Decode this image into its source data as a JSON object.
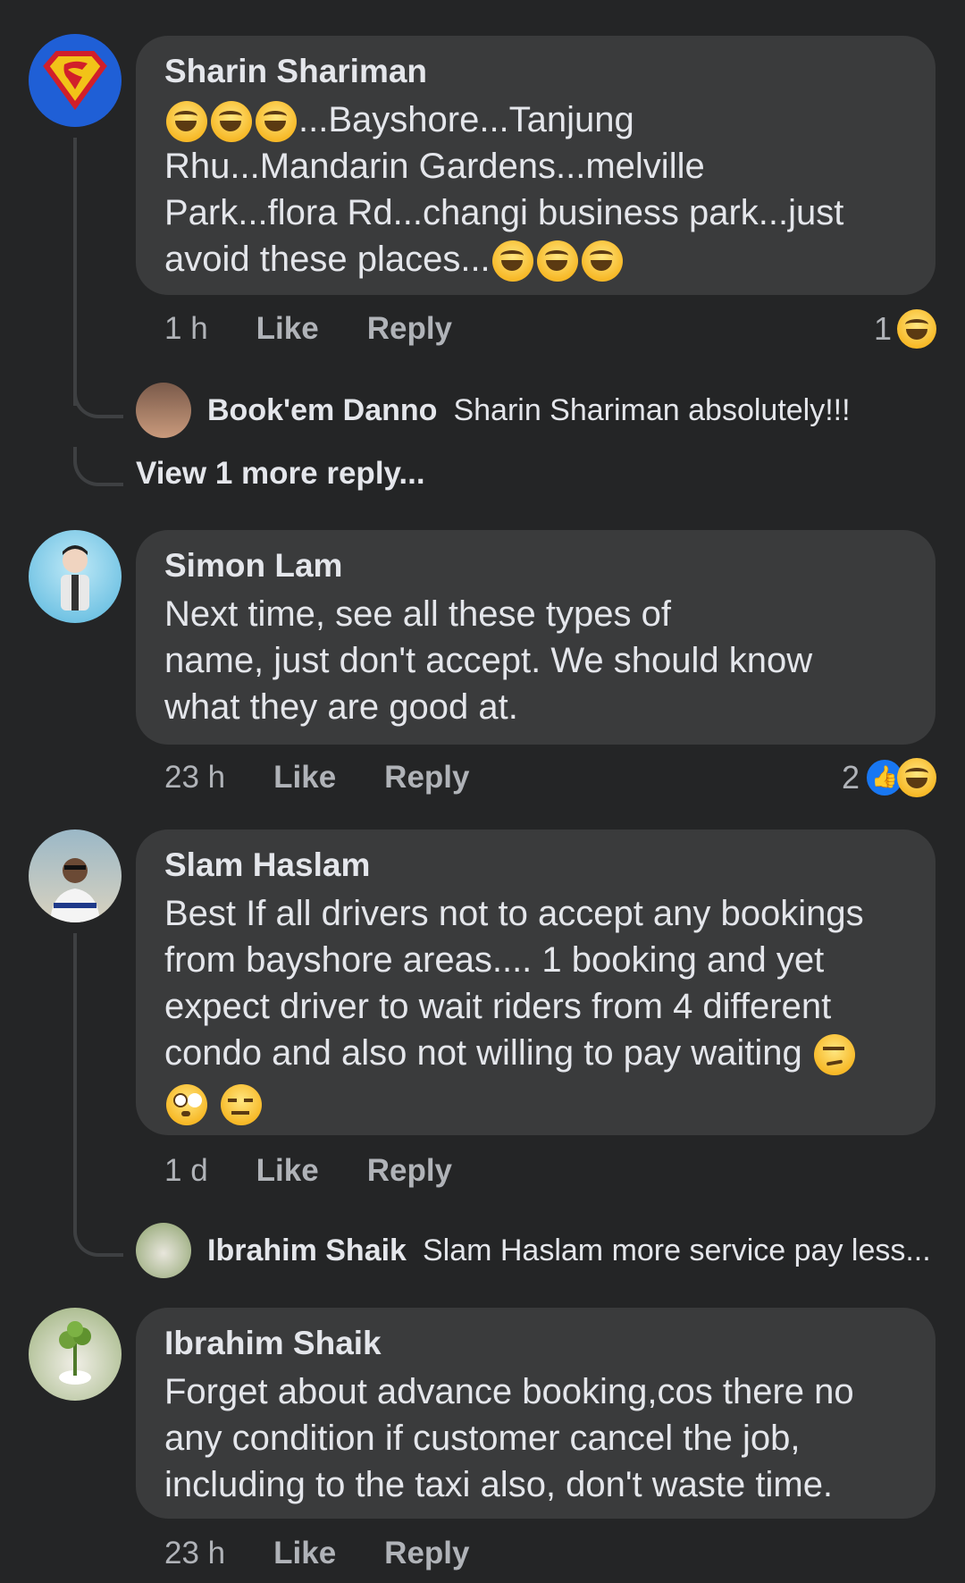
{
  "comments": [
    {
      "author": "Sharin Shariman",
      "text_lines": [
        "...Bayshore...Tanjung",
        "Rhu...Mandarin Gardens...melville",
        "Park...flora Rd...changi business park...just",
        "avoid these places..."
      ],
      "time": "1 h",
      "like_label": "Like",
      "reply_label": "Reply",
      "reaction_count": "1",
      "reactions": [
        "laugh-icon"
      ],
      "reply": {
        "author": "Book'em Danno",
        "text": "Sharin Shariman absolutely!!!"
      },
      "view_more": "View 1 more reply..."
    },
    {
      "author": "Simon Lam",
      "text_lines": [
        "Next time, see all these types of",
        "name, just don't accept. We should know",
        "what they are good at."
      ],
      "time": "23 h",
      "like_label": "Like",
      "reply_label": "Reply",
      "reaction_count": "2",
      "reactions": [
        "like-icon",
        "laugh-icon"
      ]
    },
    {
      "author": "Slam Haslam",
      "text_lines": [
        "Best If all drivers not to accept any bookings",
        "from bayshore areas.... 1 booking and yet",
        "expect driver to wait riders from 4 different",
        "condo and also not willing to pay waiting"
      ],
      "time": "1 d",
      "like_label": "Like",
      "reply_label": "Reply",
      "reply": {
        "author": "Ibrahim Shaik",
        "text": "Slam Haslam more service pay less..."
      }
    },
    {
      "author": "Ibrahim Shaik",
      "text_lines": [
        "Forget about advance booking,cos there no",
        "any condition if customer cancel the job,",
        "including to the taxi also, don't waste time."
      ],
      "time": "23 h",
      "like_label": "Like",
      "reply_label": "Reply"
    }
  ],
  "colors": {
    "background": "#242526",
    "bubble": "#3a3b3c",
    "text": "#e4e6eb",
    "secondary": "#b0b3b8",
    "like_blue": "#1877f2",
    "emoji_yellow": "#f7b928"
  }
}
